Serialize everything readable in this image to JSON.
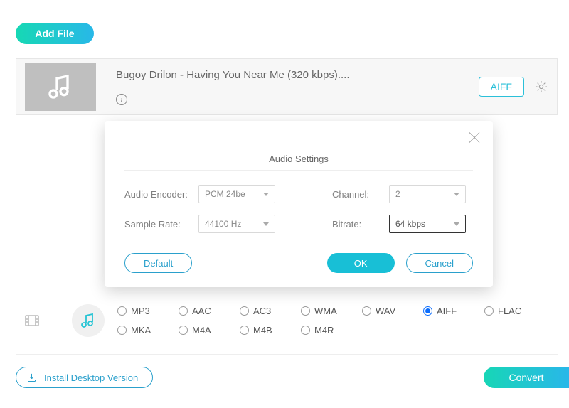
{
  "header": {
    "add_file": "Add File"
  },
  "file": {
    "title": "Bugoy Drilon - Having You Near Me (320 kbps)....",
    "tag": "AIFF"
  },
  "modal": {
    "title": "Audio Settings",
    "labels": {
      "encoder": "Audio Encoder:",
      "channel": "Channel:",
      "sample": "Sample Rate:",
      "bitrate": "Bitrate:"
    },
    "values": {
      "encoder": "PCM 24be",
      "channel": "2",
      "sample": "44100 Hz",
      "bitrate": "64 kbps"
    },
    "buttons": {
      "default": "Default",
      "ok": "OK",
      "cancel": "Cancel"
    }
  },
  "formats": {
    "row1": [
      "MP3",
      "AAC",
      "AC3",
      "WMA",
      "WAV",
      "AIFF",
      "FLAC"
    ],
    "row2": [
      "MKA",
      "M4A",
      "M4B",
      "M4R"
    ],
    "selected": "AIFF"
  },
  "footer": {
    "install": "Install Desktop Version",
    "convert": "Convert"
  }
}
